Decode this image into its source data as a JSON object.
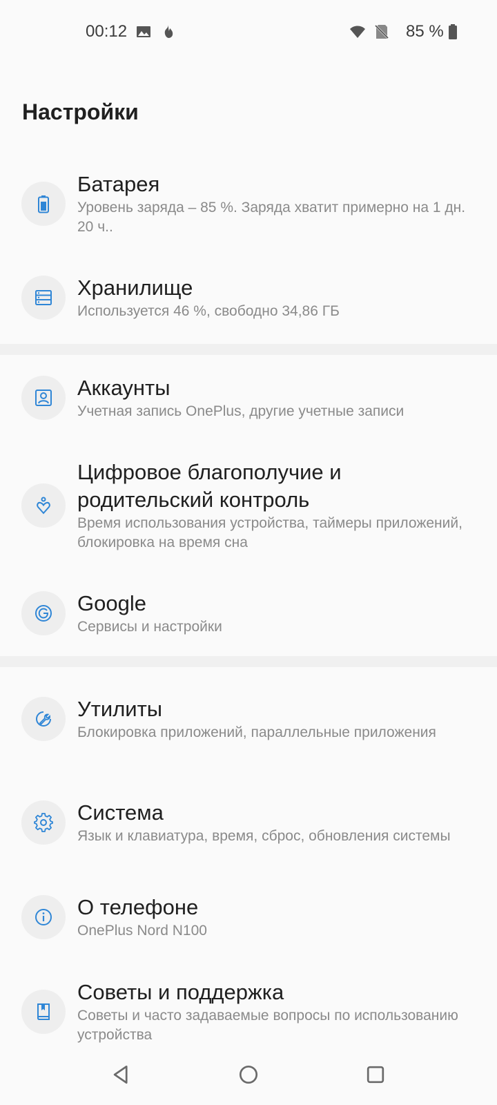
{
  "status_bar": {
    "time": "00:12",
    "battery_text": "85 %",
    "icons": [
      "image-icon",
      "fire-icon",
      "wifi-icon",
      "no-sim-icon",
      "battery-icon"
    ]
  },
  "page": {
    "title": "Настройки"
  },
  "items": [
    {
      "icon": "battery-icon",
      "title": "Батарея",
      "subtitle": "Уровень заряда – 85 %. Заряда хватит примерно на 1 дн. 20 ч.."
    },
    {
      "icon": "storage-icon",
      "title": "Хранилище",
      "subtitle": "Используется 46 %, свободно 34,86 ГБ"
    },
    {
      "icon": "account-icon",
      "title": "Аккаунты",
      "subtitle": "Учетная запись OnePlus, другие учетные записи"
    },
    {
      "icon": "wellbeing-icon",
      "title": "Цифровое благополучие и родительский контроль",
      "subtitle": "Время использования устройства, таймеры приложений, блокировка на время сна"
    },
    {
      "icon": "google-icon",
      "title": "Google",
      "subtitle": "Сервисы и настройки"
    },
    {
      "icon": "utilities-icon",
      "title": "Утилиты",
      "subtitle": "Блокировка приложений, параллельные приложения"
    },
    {
      "icon": "gear-icon",
      "title": "Система",
      "subtitle": "Язык и клавиатура, время, сброс, обновления системы"
    },
    {
      "icon": "info-icon",
      "title": "О телефоне",
      "subtitle": "OnePlus Nord N100"
    },
    {
      "icon": "book-icon",
      "title": "Советы и поддержка",
      "subtitle": "Советы и часто задаваемые вопросы по использованию устройства"
    }
  ],
  "nav_bar": {
    "buttons": [
      "back-icon",
      "home-icon",
      "recents-icon"
    ]
  },
  "colors": {
    "accent": "#2f86d6",
    "background": "#fafafa",
    "icon_circle": "#eeeeee",
    "divider": "#f0f0f0",
    "subtitle": "#8a8a8a"
  }
}
